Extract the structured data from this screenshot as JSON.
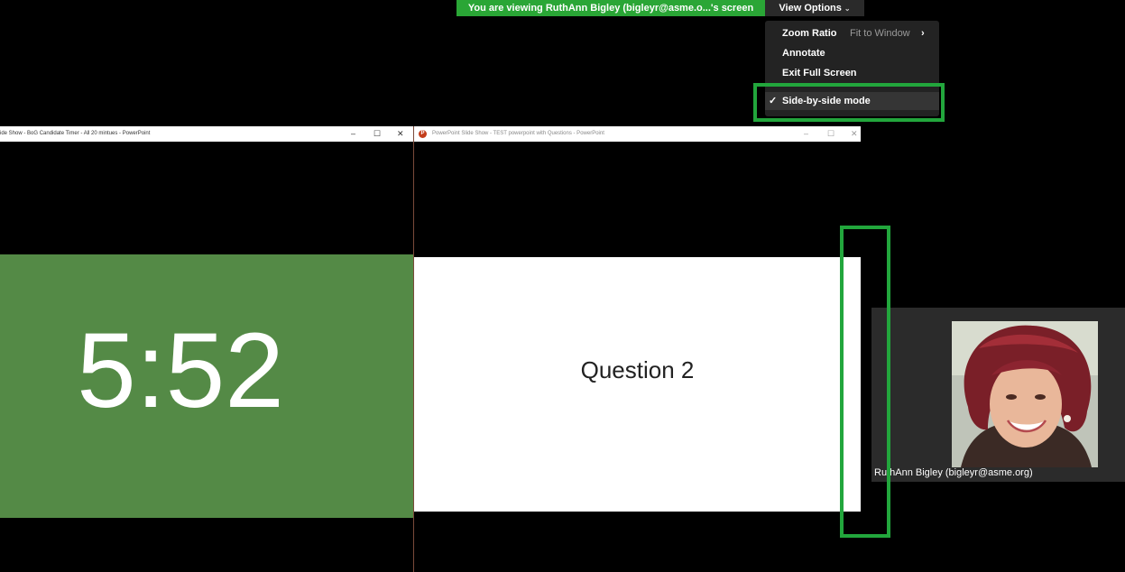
{
  "share_banner": {
    "text": "You are viewing RuthAnn Bigley (bigleyr@asme.o...'s screen"
  },
  "view_options": {
    "label": "View Options",
    "menu": {
      "zoom_ratio_label": "Zoom Ratio",
      "zoom_ratio_value": "Fit to Window",
      "annotate_label": "Annotate",
      "exit_fullscreen_label": "Exit Full Screen",
      "side_by_side_label": "Side-by-side mode",
      "side_by_side_checked": true
    }
  },
  "highlight_color": "#22a63c",
  "left_window": {
    "title": "ide Show - BoG Candidate Timer - All 20 mintues - PowerPoint",
    "slide_text": "5:52",
    "slide_color": "#548a46"
  },
  "right_window": {
    "title": "PowerPoint Slide Show - TEST powerpoint with Questions - PowerPoint",
    "slide_text": "Question 2"
  },
  "participant": {
    "name": "RuthAnn Bigley (bigleyr@asme.org)"
  },
  "icons": {
    "minimize": "–",
    "maximize": "☐",
    "close": "✕",
    "chevron_down": "⌄",
    "chevron_right": "›",
    "check": "✓"
  }
}
